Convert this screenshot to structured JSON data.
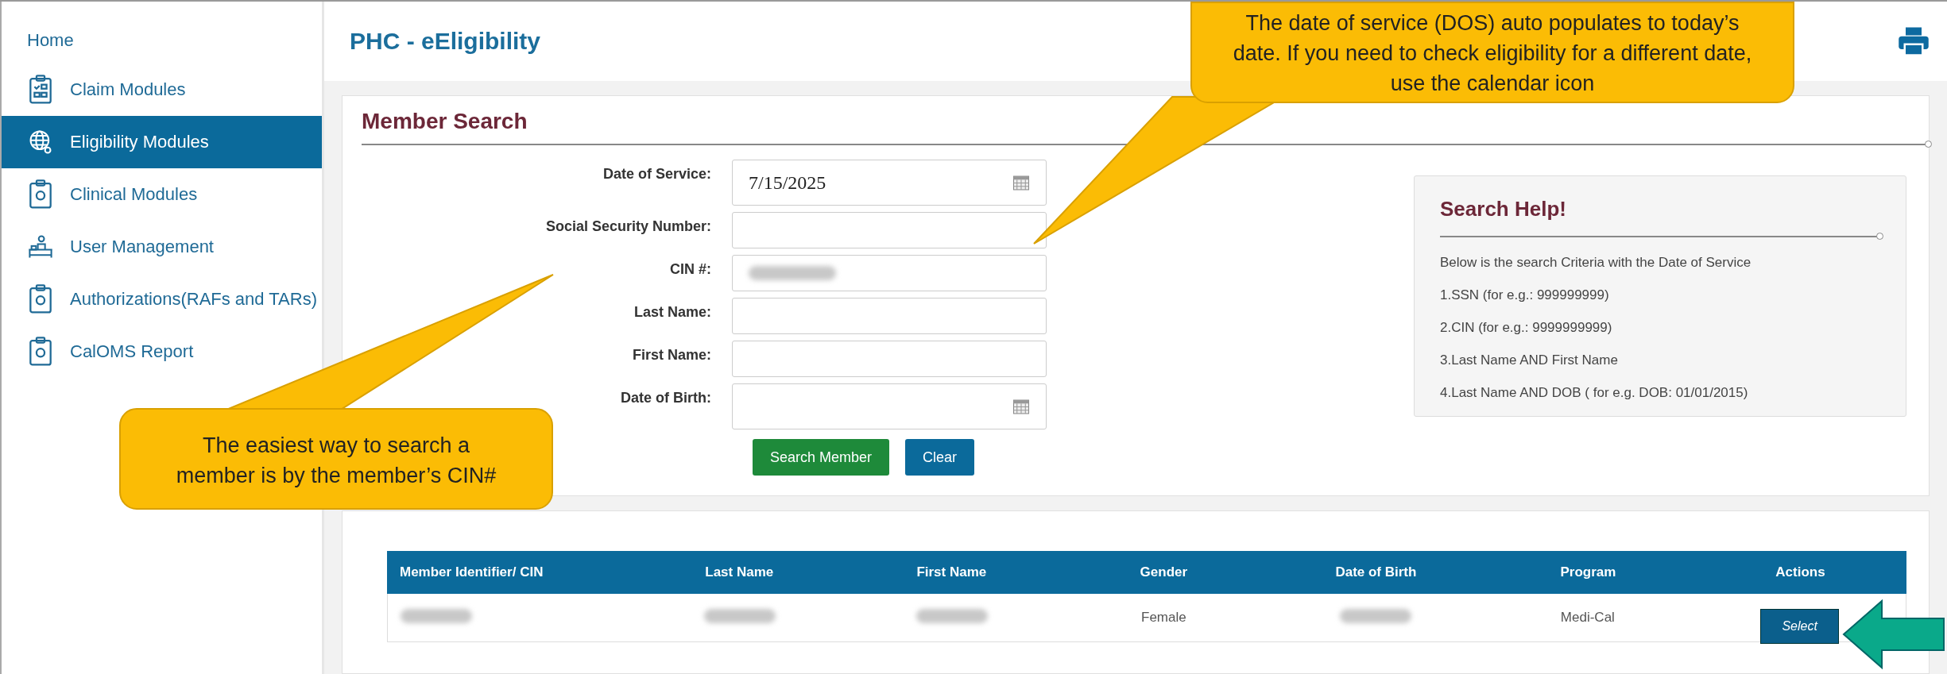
{
  "sidebar": {
    "items": [
      {
        "label": "Home",
        "kind": "none",
        "selected": false
      },
      {
        "label": "Claim Modules",
        "kind": "checklist",
        "selected": false
      },
      {
        "label": "Eligibility Modules",
        "kind": "globe",
        "selected": true
      },
      {
        "label": "Clinical Modules",
        "kind": "clipboard",
        "selected": false
      },
      {
        "label": "User Management",
        "kind": "desk",
        "selected": false
      },
      {
        "label": "Authorizations(RAFs and TARs)",
        "kind": "clipboard",
        "selected": false
      },
      {
        "label": "CalOMS Report",
        "kind": "clipboard",
        "selected": false
      }
    ]
  },
  "header": {
    "title": "PHC - eEligibility"
  },
  "member_search": {
    "title": "Member Search",
    "fields": [
      {
        "label": "Date of Service:",
        "value": "7/15/2025",
        "kind": "date"
      },
      {
        "label": "Social Security Number:",
        "kind": "text"
      },
      {
        "label": "CIN #:",
        "kind": "redacted"
      },
      {
        "label": "Last Name:",
        "kind": "text"
      },
      {
        "label": "First Name:",
        "kind": "text"
      },
      {
        "label": "Date of Birth:",
        "kind": "date"
      }
    ],
    "buttons": [
      {
        "label": "Search Member",
        "kind": "primary"
      },
      {
        "label": "Clear",
        "kind": "secondary"
      }
    ]
  },
  "search_help": {
    "title": "Search Help!",
    "lines": [
      "Below is the search Criteria with the Date of Service",
      "1.SSN (for e.g.: 999999999)",
      "2.CIN (for e.g.: 9999999999)",
      "3.Last Name AND First Name",
      "4.Last Name AND DOB ( for e.g. DOB: 01/01/2015)"
    ]
  },
  "results": {
    "columns": [
      "Member Identifier/ CIN",
      "Last Name",
      "First Name",
      "Gender",
      "Date of Birth",
      "Program",
      "Actions"
    ],
    "rows": [
      {
        "cells": [
          {
            "redacted": true
          },
          {
            "redacted": true
          },
          {
            "redacted": true
          },
          {
            "redacted": false,
            "text": "Female"
          },
          {
            "redacted": true
          },
          {
            "redacted": false,
            "text": "Medi-Cal"
          }
        ],
        "action": "Select"
      }
    ]
  },
  "annotations": [
    {
      "kind": "top",
      "text": "The date of service (DOS) auto populates to today’s date. If you need to check eligibility for a different date, use the calendar icon"
    },
    {
      "kind": "left",
      "text": "The easiest way to search a member is by the member’s CIN#"
    }
  ]
}
